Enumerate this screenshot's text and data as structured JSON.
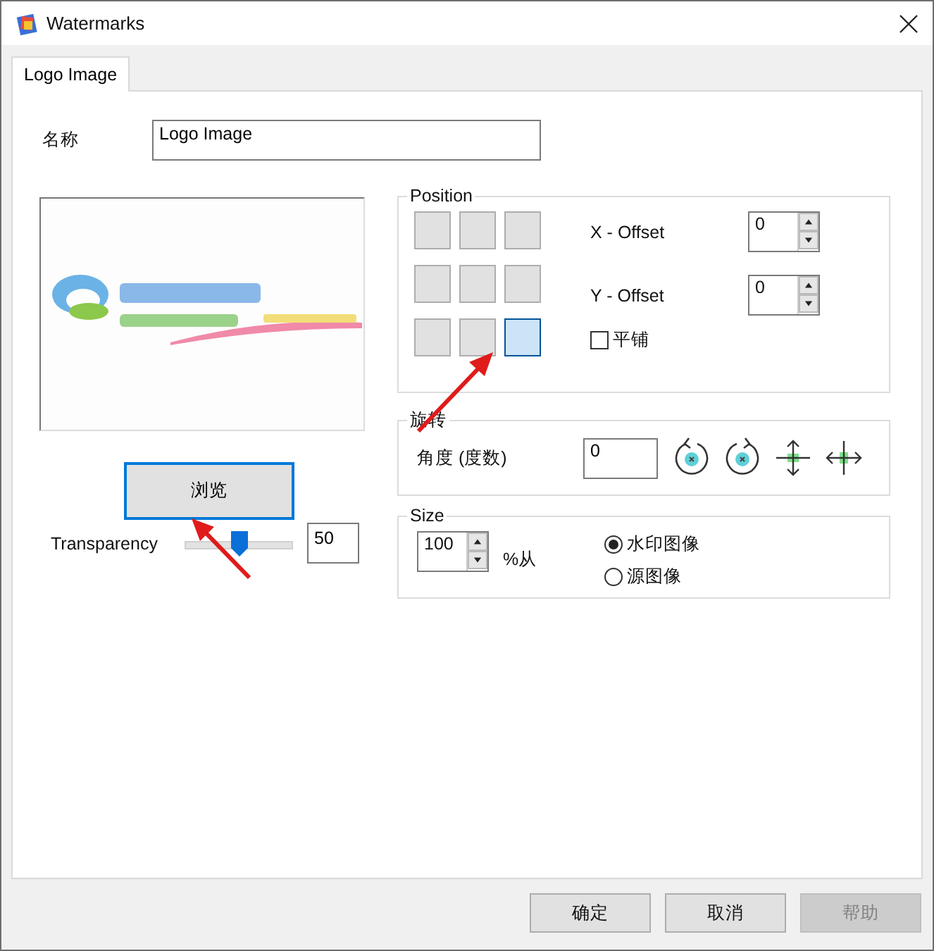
{
  "window": {
    "title": "Watermarks"
  },
  "tabs": [
    {
      "label": "Logo Image",
      "selected": true
    }
  ],
  "name_field": {
    "label": "名称",
    "value": "Logo Image"
  },
  "browse_button": "浏览",
  "transparency": {
    "label": "Transparency",
    "level": 0.5,
    "value": "50"
  },
  "position": {
    "title": "Position",
    "cells": [
      {
        "selected": false
      },
      {
        "selected": false
      },
      {
        "selected": false
      },
      {
        "selected": false
      },
      {
        "selected": false
      },
      {
        "selected": false
      },
      {
        "selected": false
      },
      {
        "selected": false
      },
      {
        "selected": true
      }
    ],
    "x_offset": {
      "label": "X - Offset",
      "value": "0"
    },
    "y_offset": {
      "label": "Y - Offset",
      "value": "0"
    },
    "tile": {
      "label": "平铺",
      "checked": false
    }
  },
  "rotation": {
    "title": "旋转",
    "label": "角度 (度数)",
    "value": "0"
  },
  "size": {
    "title": "Size",
    "value": "100",
    "unit": "%从",
    "options": [
      {
        "label": "水印图像",
        "selected": true
      },
      {
        "label": "源图像",
        "selected": false
      }
    ]
  },
  "buttons": [
    {
      "label": "确定",
      "disabled": false
    },
    {
      "label": "取消",
      "disabled": false
    },
    {
      "label": "帮助",
      "disabled": true
    }
  ]
}
